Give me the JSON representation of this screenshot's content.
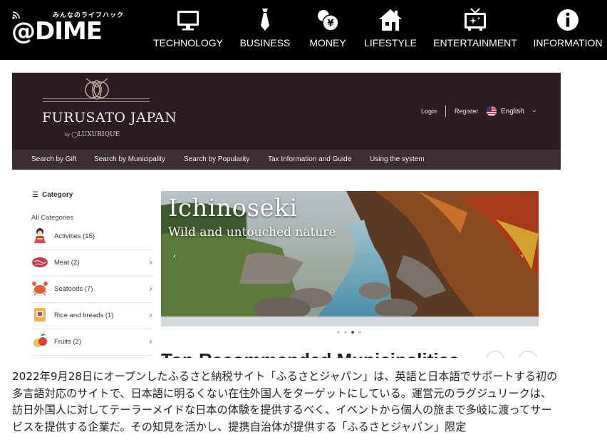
{
  "site": {
    "tagline": "みんなのライフハック",
    "wordmark": "@DIME",
    "nav": [
      {
        "label": "TECHNOLOGY",
        "icon": "monitor-icon"
      },
      {
        "label": "BUSINESS",
        "icon": "necktie-icon"
      },
      {
        "label": "MONEY",
        "icon": "coins-yen-icon"
      },
      {
        "label": "LIFESTYLE",
        "icon": "house-icon"
      },
      {
        "label": "ENTERTAINMENT",
        "icon": "tv-sparkle-icon"
      },
      {
        "label": "INFORMATION",
        "icon": "info-icon"
      }
    ]
  },
  "screenshot": {
    "brand_title": "FURUSATO JAPAN",
    "brand_by_prefix": "by",
    "brand_by": "LUXURIQUE",
    "login": "Login",
    "register": "Register",
    "language": "English",
    "menu": [
      "Search by Gift",
      "Search by Municipality",
      "Search by Popularity",
      "Tax Information and Guide",
      "Using the system"
    ],
    "category_heading": "Category",
    "all_categories": "All Categories",
    "categories": [
      {
        "label": "Activities (15)",
        "icon": "geisha-icon",
        "arrow": ""
      },
      {
        "label": "Meat (2)",
        "icon": "meat-icon",
        "arrow": "›"
      },
      {
        "label": "Seafoods (7)",
        "icon": "crab-icon",
        "arrow": "›"
      },
      {
        "label": "Rice and breads (1)",
        "icon": "rice-icon",
        "arrow": "›"
      },
      {
        "label": "Fruits (2)",
        "icon": "fruits-icon",
        "arrow": "›"
      }
    ],
    "banner": {
      "title": "Ichinoseki",
      "subtitle": "Wild and untouched nature"
    },
    "cut_heading": "Top Recommended Municipalities",
    "colors": {
      "header_bg": "#2b1d23",
      "menu_bg": "#3d2d34"
    }
  },
  "article": {
    "text": "2022年9月28日にオープンしたふるさと納税サイト「ふるさとジャパン」は、英語と日本語でサポートする初の多言語対応のサイトで、日本語に明るくない在住外国人をターゲットにしている。運営元のラグジュリークは、訪日外国人に対してテーラーメイドな日本の体験を提供するべく、イベントから個人の旅まで多岐に渡ってサービスを提供する企業だ。その知見を活かし、提携自治体が提供する「ふるさとジャパン」限定"
  }
}
